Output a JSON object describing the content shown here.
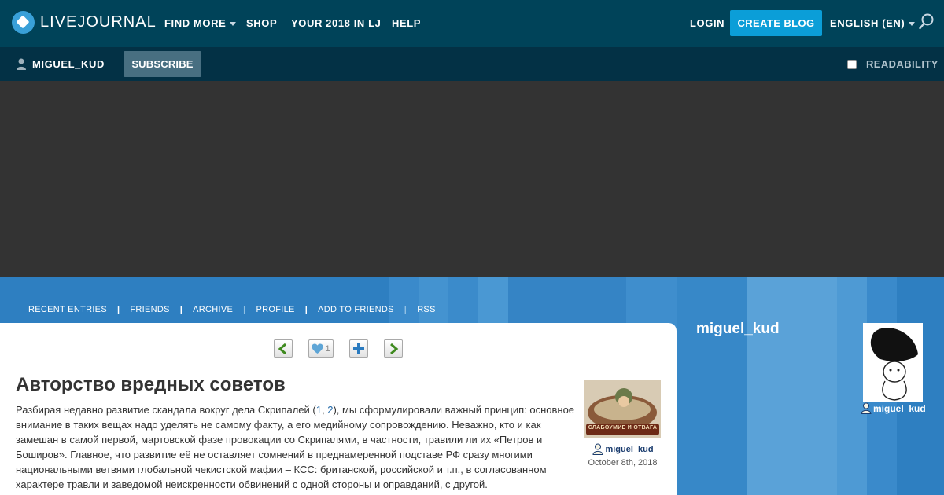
{
  "header": {
    "logo_text": "LIVEJOURNAL",
    "nav": [
      "FIND MORE",
      "SHOP",
      "YOUR 2018 IN LJ",
      "HELP"
    ],
    "login_label": "LOGIN",
    "create_blog_label": "CREATE BLOG",
    "language_label": "ENGLISH (EN)",
    "search_icon": "search-icon"
  },
  "userbar": {
    "username": "MIGUEL_KUD",
    "subscribe_label": "SUBSCRIBE",
    "readability_label": "READABILITY"
  },
  "journal_nav": [
    "RECENT ENTRIES",
    "FRIENDS",
    "ARCHIVE",
    "PROFILE",
    "ADD TO FRIENDS",
    "RSS"
  ],
  "entry": {
    "like_count": "1",
    "title": "Авторство вредных советов",
    "body_before_links": "Разбирая недавно развитие скандала вокруг дела Скрипалей (",
    "link1": "1",
    "link_sep": ", ",
    "link2": "2",
    "body_after_links": "), мы сформулировали важный принцип: основное внимание в таких вещах надо уделять не самому факту, а его медийному сопровождению. Неважно, кто и как замешан в самой первой, мартовской фазе провокации со Скрипалями, в частности, травили ли их «Петров и Боширов». Главное, что развитие её не оставляет сомнений в преднамеренной подставе РФ сразу многими национальными ветвями глобальной чекистской мафии – КСС: британской, российской и т.п., в согласованном характере травли и заведомой неискренности обвинений с одной стороны и оправданий, с другой.",
    "poster_name": "miguel_kud",
    "poster_banner_text": "СЛАБОУМИЕ И ОТВАГА",
    "date": "October 8th, 2018"
  },
  "profile": {
    "journal_name": "miguel_kud",
    "link_name": "miguel_kud"
  },
  "colors": {
    "topbar": "#004359",
    "userbar": "#033145",
    "accent": "#0b9ed8",
    "banner": "#333333",
    "band": "#2e7fc1"
  }
}
